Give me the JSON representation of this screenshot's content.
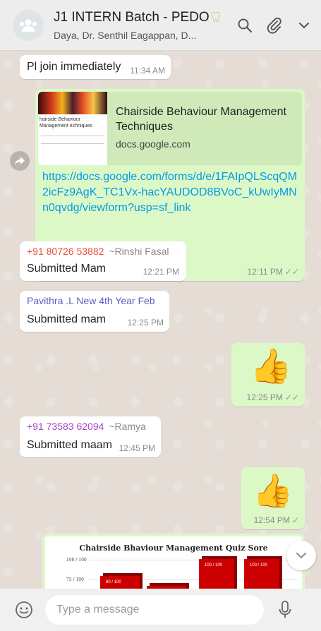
{
  "header": {
    "title": "J1 INTERN Batch - PEDO",
    "subtitle": "Daya, Dr. Senthil Eagappan, D..."
  },
  "messages": {
    "m1": {
      "text": "Pl join immediately",
      "time": "11:34 AM"
    },
    "link": {
      "preview_title": "Chairside Behaviour Management Techniques",
      "preview_domain": "docs.google.com",
      "thumb_caption": "hairside Behaviour Management echniques",
      "url": "https://docs.google.com/forms/d/e/1FAIpQLScqQM2icFz9AgK_TC1Vx-hacYAUDOD8BVoC_kUwIyMNn0qvdg/viewform?usp=sf_link",
      "time": "12:11 PM"
    },
    "m3": {
      "sender": "+91 80726 53882",
      "alias": "~Rinshi Fasal",
      "text": "Submitted Mam",
      "time": "12:21 PM"
    },
    "m4": {
      "sender": "Pavithra .L New 4th Year Feb",
      "text": "Submitted mam",
      "time": "12:25 PM"
    },
    "m5": {
      "time": "12:25 PM"
    },
    "m6": {
      "sender": "+91 73583 62094",
      "alias": "~Ramya",
      "text": "Submitted maam",
      "time": "12:45 PM"
    },
    "m7": {
      "time": "12:54 PM"
    },
    "chart": {
      "title": "Chairside Bhaviour Management Quiz Sore",
      "y_ticks": [
        "100 / 100",
        "75 / 100"
      ],
      "bar_labels": [
        "80 / 100",
        "100 / 100",
        "100 / 100"
      ]
    }
  },
  "composer": {
    "placeholder": "Type a message"
  },
  "colors": {
    "header_bg": "#ededed",
    "chat_bg": "#e5ddd5",
    "outgoing_bubble": "#dcf8c6",
    "incoming_bubble": "#ffffff",
    "link": "#039be5",
    "sender_red": "#e8513d",
    "sender_purple": "#8e44ad",
    "sender_blue": "#5b5fc7",
    "bar_red": "#cc0000"
  },
  "icons": [
    "group-avatar-icon",
    "tooth-icon",
    "search-icon",
    "attach-icon",
    "chevron-down-icon",
    "forward-icon",
    "double-check-icon",
    "single-check-icon",
    "thumbs-up-emoji",
    "scroll-down-icon",
    "emoji-icon",
    "mic-icon"
  ]
}
